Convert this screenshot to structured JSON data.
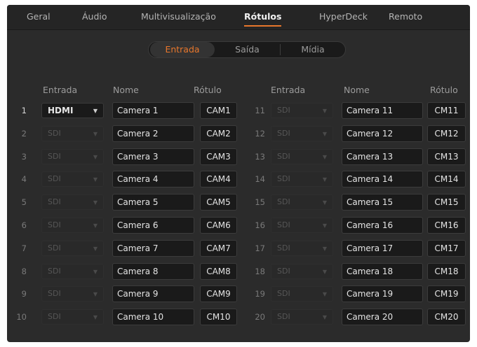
{
  "tabs": [
    {
      "label": "Geral",
      "active": false
    },
    {
      "label": "Áudio",
      "active": false
    },
    {
      "label": "Multivisualização",
      "active": false
    },
    {
      "label": "Rótulos",
      "active": true
    },
    {
      "label": "HyperDeck",
      "active": false
    },
    {
      "label": "Remoto",
      "active": false
    }
  ],
  "segments": [
    {
      "label": "Entrada",
      "active": true
    },
    {
      "label": "Saída",
      "active": false
    },
    {
      "label": "Mídia",
      "active": false
    }
  ],
  "headers": {
    "input": "Entrada",
    "name": "Nome",
    "label": "Rótulo"
  },
  "rows": [
    {
      "num": "1",
      "input": "HDMI",
      "name": "Camera 1",
      "label": "CAM1"
    },
    {
      "num": "2",
      "input": "SDI",
      "name": "Camera 2",
      "label": "CAM2"
    },
    {
      "num": "3",
      "input": "SDI",
      "name": "Camera 3",
      "label": "CAM3"
    },
    {
      "num": "4",
      "input": "SDI",
      "name": "Camera 4",
      "label": "CAM4"
    },
    {
      "num": "5",
      "input": "SDI",
      "name": "Camera 5",
      "label": "CAM5"
    },
    {
      "num": "6",
      "input": "SDI",
      "name": "Camera 6",
      "label": "CAM6"
    },
    {
      "num": "7",
      "input": "SDI",
      "name": "Camera 7",
      "label": "CAM7"
    },
    {
      "num": "8",
      "input": "SDI",
      "name": "Camera 8",
      "label": "CAM8"
    },
    {
      "num": "9",
      "input": "SDI",
      "name": "Camera 9",
      "label": "CAM9"
    },
    {
      "num": "10",
      "input": "SDI",
      "name": "Camera 10",
      "label": "CM10"
    },
    {
      "num": "11",
      "input": "SDI",
      "name": "Camera 11",
      "label": "CM11"
    },
    {
      "num": "12",
      "input": "SDI",
      "name": "Camera 12",
      "label": "CM12"
    },
    {
      "num": "13",
      "input": "SDI",
      "name": "Camera 13",
      "label": "CM13"
    },
    {
      "num": "14",
      "input": "SDI",
      "name": "Camera 14",
      "label": "CM14"
    },
    {
      "num": "15",
      "input": "SDI",
      "name": "Camera 15",
      "label": "CM15"
    },
    {
      "num": "16",
      "input": "SDI",
      "name": "Camera 16",
      "label": "CM16"
    },
    {
      "num": "17",
      "input": "SDI",
      "name": "Camera 17",
      "label": "CM17"
    },
    {
      "num": "18",
      "input": "SDI",
      "name": "Camera 18",
      "label": "CM18"
    },
    {
      "num": "19",
      "input": "SDI",
      "name": "Camera 19",
      "label": "CM19"
    },
    {
      "num": "20",
      "input": "SDI",
      "name": "Camera 20",
      "label": "CM20"
    }
  ],
  "colors": {
    "accent": "#e8772c",
    "background": "#2b2b2b",
    "field": "#1a1a1a"
  }
}
